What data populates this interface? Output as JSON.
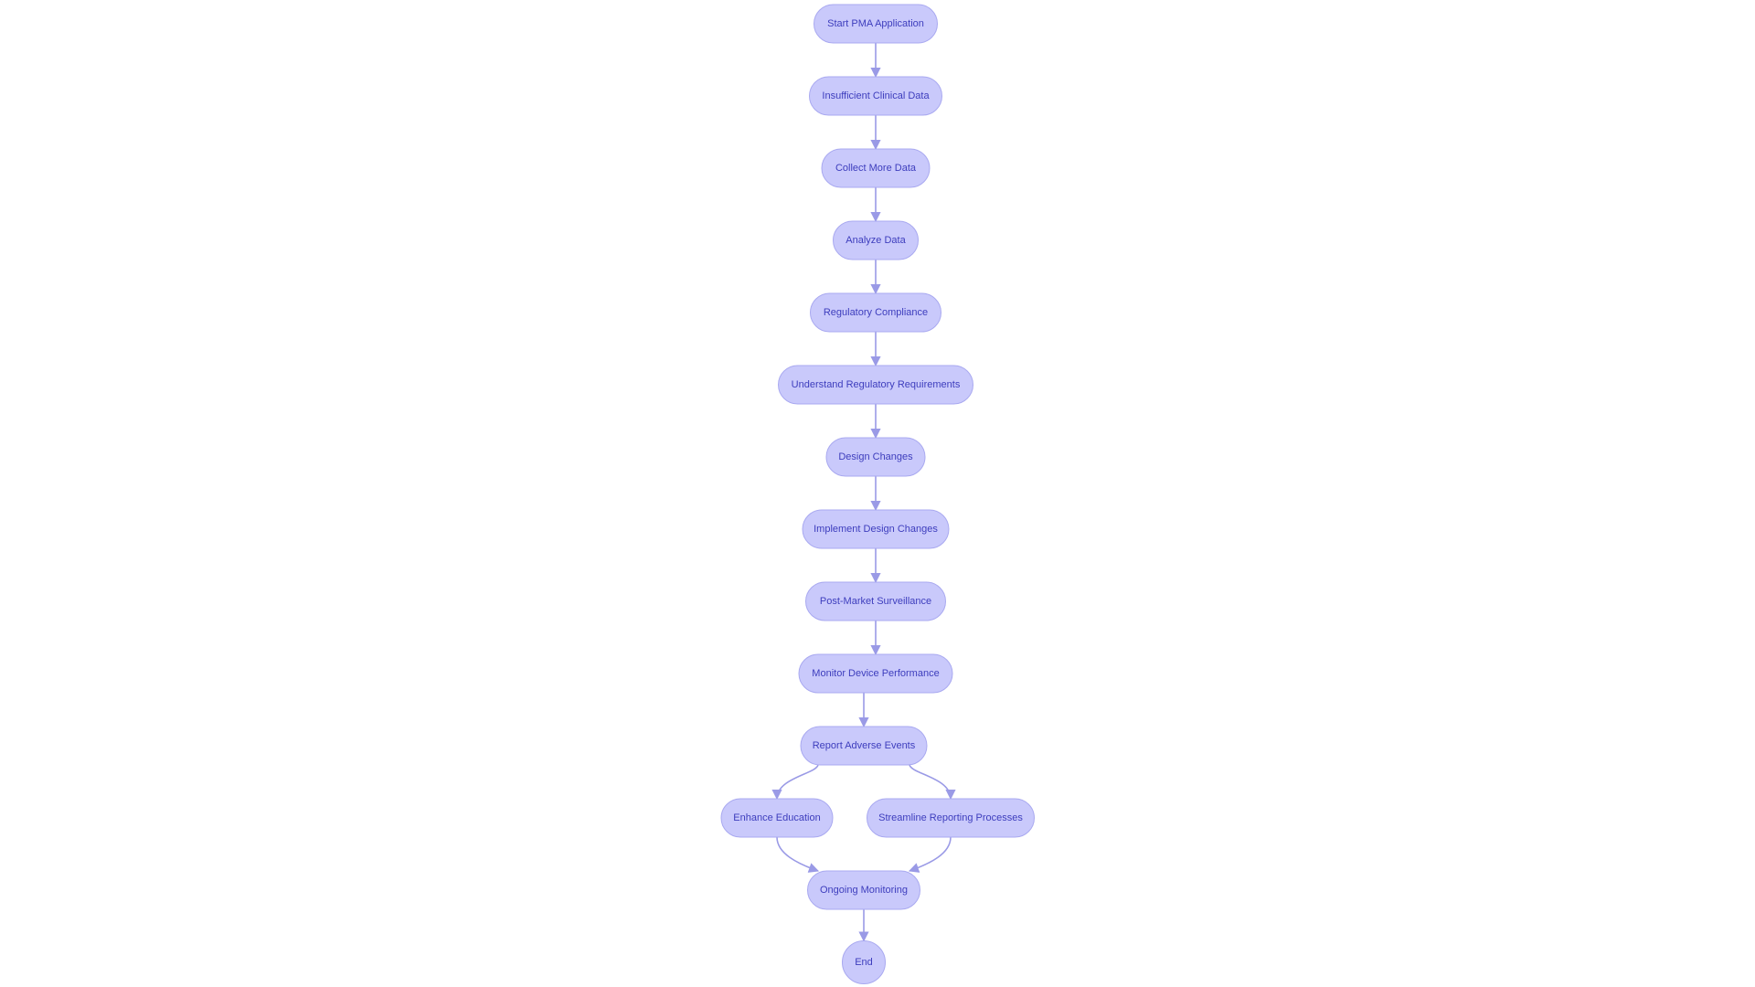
{
  "diagram": {
    "type": "flowchart",
    "direction": "top-down",
    "colors": {
      "node_fill": "#c9c9fb",
      "node_stroke": "#a9a9f0",
      "text": "#3d3dbd",
      "edge": "#9a9ae6"
    },
    "nodes": [
      {
        "id": "start",
        "label": "Start PMA Application"
      },
      {
        "id": "insufficient",
        "label": "Insufficient Clinical Data"
      },
      {
        "id": "collect",
        "label": "Collect More Data"
      },
      {
        "id": "analyze",
        "label": "Analyze Data"
      },
      {
        "id": "regulatory",
        "label": "Regulatory Compliance"
      },
      {
        "id": "understand",
        "label": "Understand Regulatory Requirements"
      },
      {
        "id": "design",
        "label": "Design Changes"
      },
      {
        "id": "implement",
        "label": "Implement Design Changes"
      },
      {
        "id": "post",
        "label": "Post-Market Surveillance"
      },
      {
        "id": "monitor",
        "label": "Monitor Device Performance"
      },
      {
        "id": "report",
        "label": "Report Adverse Events"
      },
      {
        "id": "enhance",
        "label": "Enhance Education"
      },
      {
        "id": "streamline",
        "label": "Streamline Reporting Processes"
      },
      {
        "id": "ongoing",
        "label": "Ongoing Monitoring"
      },
      {
        "id": "end",
        "label": "End"
      }
    ],
    "edges": [
      [
        "start",
        "insufficient"
      ],
      [
        "insufficient",
        "collect"
      ],
      [
        "collect",
        "analyze"
      ],
      [
        "analyze",
        "regulatory"
      ],
      [
        "regulatory",
        "understand"
      ],
      [
        "understand",
        "design"
      ],
      [
        "design",
        "implement"
      ],
      [
        "implement",
        "post"
      ],
      [
        "post",
        "monitor"
      ],
      [
        "monitor",
        "report"
      ],
      [
        "report",
        "enhance"
      ],
      [
        "report",
        "streamline"
      ],
      [
        "enhance",
        "ongoing"
      ],
      [
        "streamline",
        "ongoing"
      ],
      [
        "ongoing",
        "end"
      ]
    ]
  }
}
